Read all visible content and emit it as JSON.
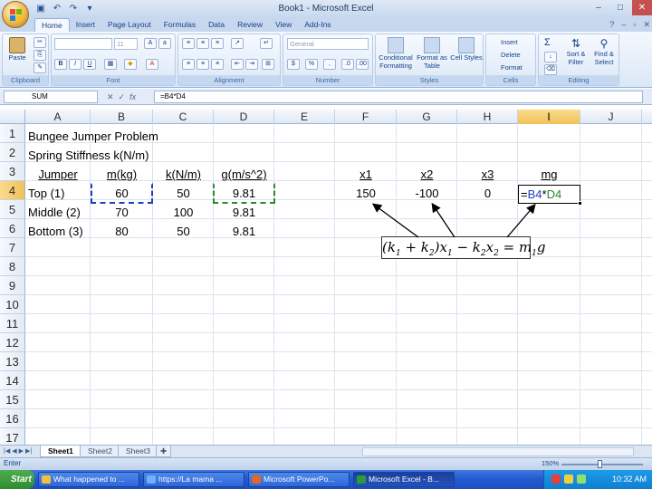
{
  "window": {
    "title": "Book1 - Microsoft Excel",
    "controls": {
      "minimize": "–",
      "maximize": "□",
      "close": "✕"
    }
  },
  "quick_access": [
    "save-icon",
    "undo-icon",
    "redo-icon",
    "customize-icon"
  ],
  "ribbon_tabs": [
    "Home",
    "Insert",
    "Page Layout",
    "Formulas",
    "Data",
    "Review",
    "View",
    "Add-Ins"
  ],
  "ribbon": {
    "clipboard": {
      "label": "Clipboard",
      "paste": "Paste"
    },
    "font": {
      "label": "Font",
      "font_name": "",
      "font_size": "11"
    },
    "alignment": {
      "label": "Alignment"
    },
    "number": {
      "label": "Number",
      "format": "General",
      "currency": "$",
      "percent": "%",
      "comma": ","
    },
    "styles": {
      "label": "Styles",
      "conditional": "Conditional Formatting",
      "format_table": "Format as Table",
      "cell_styles": "Cell Styles"
    },
    "cells": {
      "label": "Cells",
      "insert": "Insert",
      "delete": "Delete",
      "format": "Format"
    },
    "editing": {
      "label": "Editing",
      "sum": "Σ",
      "sort": "Sort & Filter",
      "find": "Find & Select"
    }
  },
  "formula_bar": {
    "name_box": "SUM",
    "cancel": "✕",
    "enter": "✓",
    "fx": "fx",
    "formula": "=B4*D4"
  },
  "columns": [
    "A",
    "B",
    "C",
    "D",
    "E",
    "F",
    "G",
    "H",
    "I",
    "J"
  ],
  "rows": [
    "1",
    "2",
    "3",
    "4",
    "5",
    "6",
    "7",
    "8",
    "9",
    "10",
    "11",
    "12",
    "13",
    "14",
    "15",
    "16",
    "17"
  ],
  "cells": {
    "A1": "Bungee Jumper Problem",
    "A2": "Spring Stiffness k(N/m)",
    "A3": "Jumper",
    "B3": "m(kg)",
    "C3": "k(N/m)",
    "D3": "g(m/s^2)",
    "F3": "x1",
    "G3": "x2",
    "H3": "x3",
    "I3": "mg",
    "A4": "Top (1)",
    "B4": "60",
    "C4": "50",
    "D4": "9.81",
    "F4": "150",
    "G4": "-100",
    "H4": "0",
    "I4_parts": {
      "eq": "=",
      "ref1": "B4",
      "op": "*",
      "ref2": "D4"
    },
    "A5": "Middle (2)",
    "B5": "70",
    "C5": "100",
    "D5": "9.81",
    "A6": "Bottom (3)",
    "B6": "80",
    "C6": "50",
    "D6": "9.81"
  },
  "equation": {
    "k1": "k",
    "k1_sub": "1",
    "k2": "k",
    "k2_sub": "2",
    "x1": "x",
    "x1_sub": "1",
    "k2b": "k",
    "k2b_sub": "2",
    "x2": "x",
    "x2_sub": "2",
    "m1": "m",
    "m1_sub": "1",
    "g": "g"
  },
  "sheets": [
    "Sheet1",
    "Sheet2",
    "Sheet3"
  ],
  "active_sheet": "Sheet1",
  "status": {
    "mode": "Enter",
    "zoom": "150%"
  },
  "taskbar": {
    "start": "Start",
    "tasks": [
      "What happened to ...",
      "https://La mama ...",
      "Microsoft PowerPo...",
      "Microsoft Excel - B..."
    ],
    "clock": "10:32 AM"
  },
  "colors": {
    "ref_blue": "#1f3fbf",
    "ref_green": "#2a8a2a",
    "ribbon_bg": "#dbe7f6",
    "taskbar": "#245bd0"
  }
}
